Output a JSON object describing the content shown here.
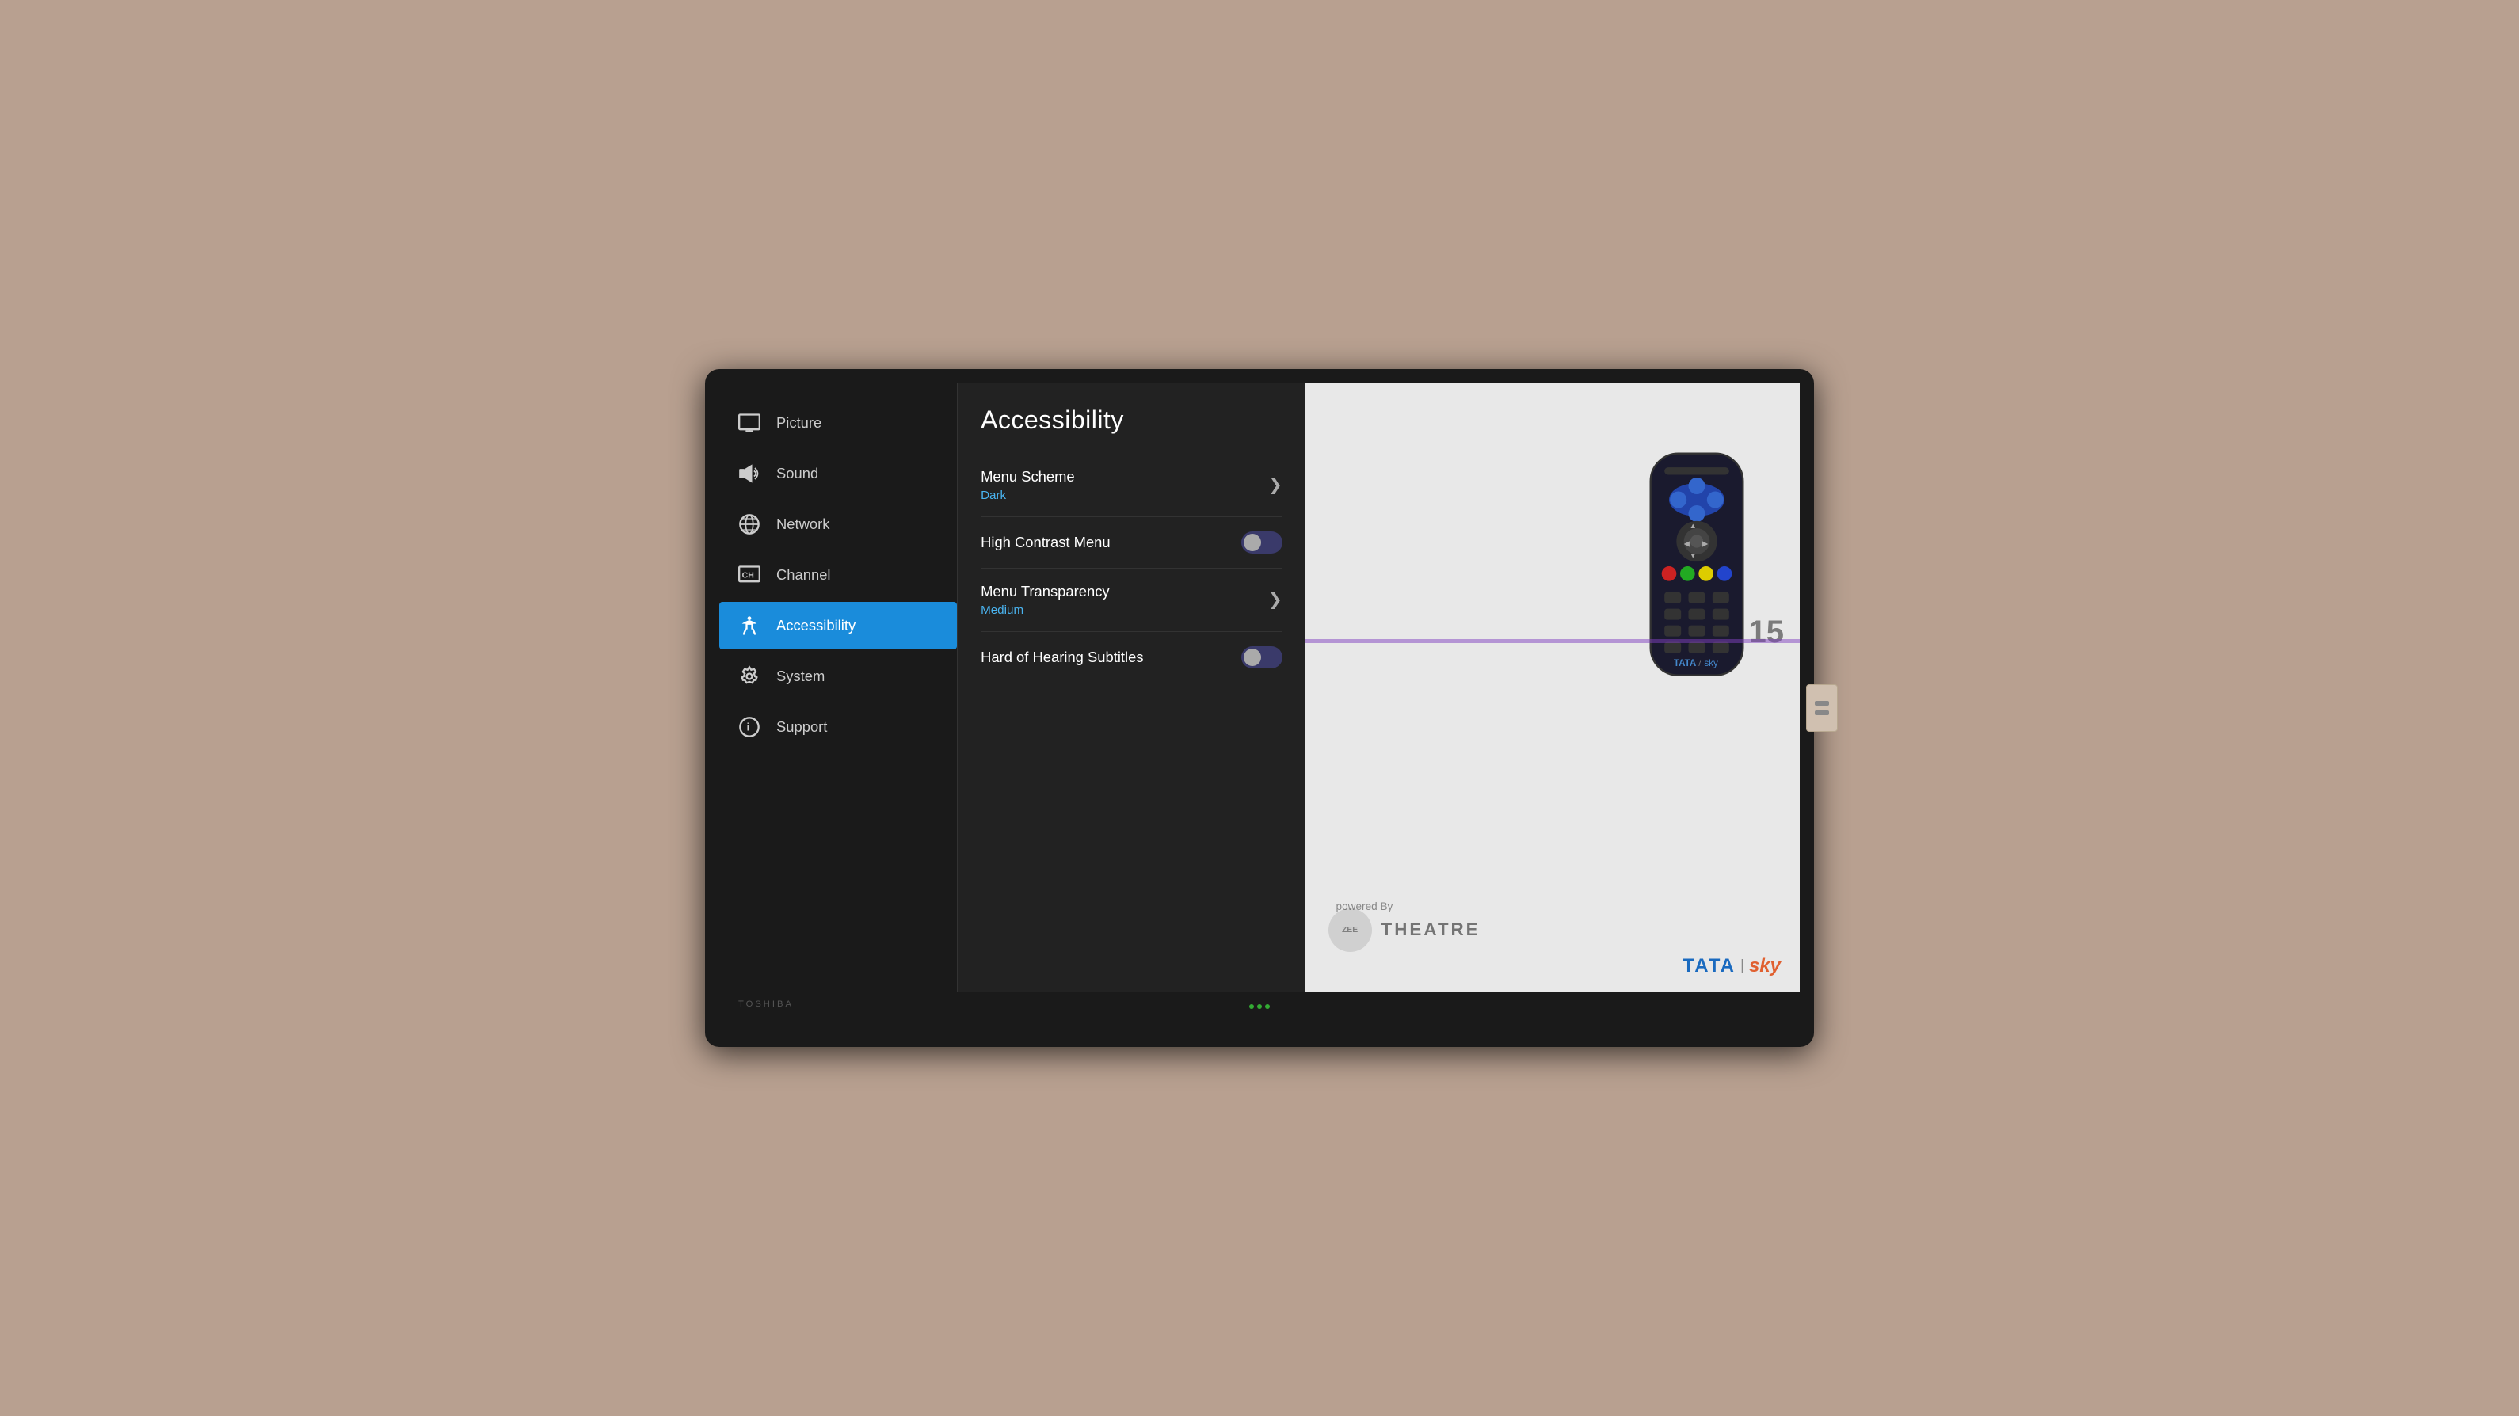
{
  "sidebar": {
    "items": [
      {
        "id": "picture",
        "label": "Picture",
        "icon": "picture-icon",
        "active": false
      },
      {
        "id": "sound",
        "label": "Sound",
        "icon": "sound-icon",
        "active": false
      },
      {
        "id": "network",
        "label": "Network",
        "icon": "network-icon",
        "active": false
      },
      {
        "id": "channel",
        "label": "Channel",
        "icon": "channel-icon",
        "active": false
      },
      {
        "id": "accessibility",
        "label": "Accessibility",
        "icon": "accessibility-icon",
        "active": true
      },
      {
        "id": "system",
        "label": "System",
        "icon": "system-icon",
        "active": false
      },
      {
        "id": "support",
        "label": "Support",
        "icon": "support-icon",
        "active": false
      }
    ]
  },
  "main": {
    "title": "Accessibility",
    "settings": [
      {
        "id": "menu-scheme",
        "label": "Menu Scheme",
        "value": "Dark",
        "type": "navigate",
        "toggle": null
      },
      {
        "id": "high-contrast-menu",
        "label": "High Contrast Menu",
        "value": null,
        "type": "toggle",
        "toggle": "off"
      },
      {
        "id": "menu-transparency",
        "label": "Menu Transparency",
        "value": "Medium",
        "type": "navigate",
        "toggle": null
      },
      {
        "id": "hard-of-hearing-subtitles",
        "label": "Hard of Hearing Subtitles",
        "value": null,
        "type": "toggle",
        "toggle": "off"
      }
    ]
  },
  "preview": {
    "channel_number": "15",
    "powered_by": "powered By",
    "zee_theatre": "THEATRE",
    "zee_prefix": "ZEE",
    "tata_text": "TATA",
    "sky_text": "sky",
    "brand": "TOSHIBA"
  },
  "colors": {
    "accent_blue": "#1a8cdb",
    "value_blue": "#4ab4f0",
    "sidebar_bg": "#1a1a1a",
    "main_bg": "#222222",
    "preview_bg": "#e8e8e8"
  }
}
